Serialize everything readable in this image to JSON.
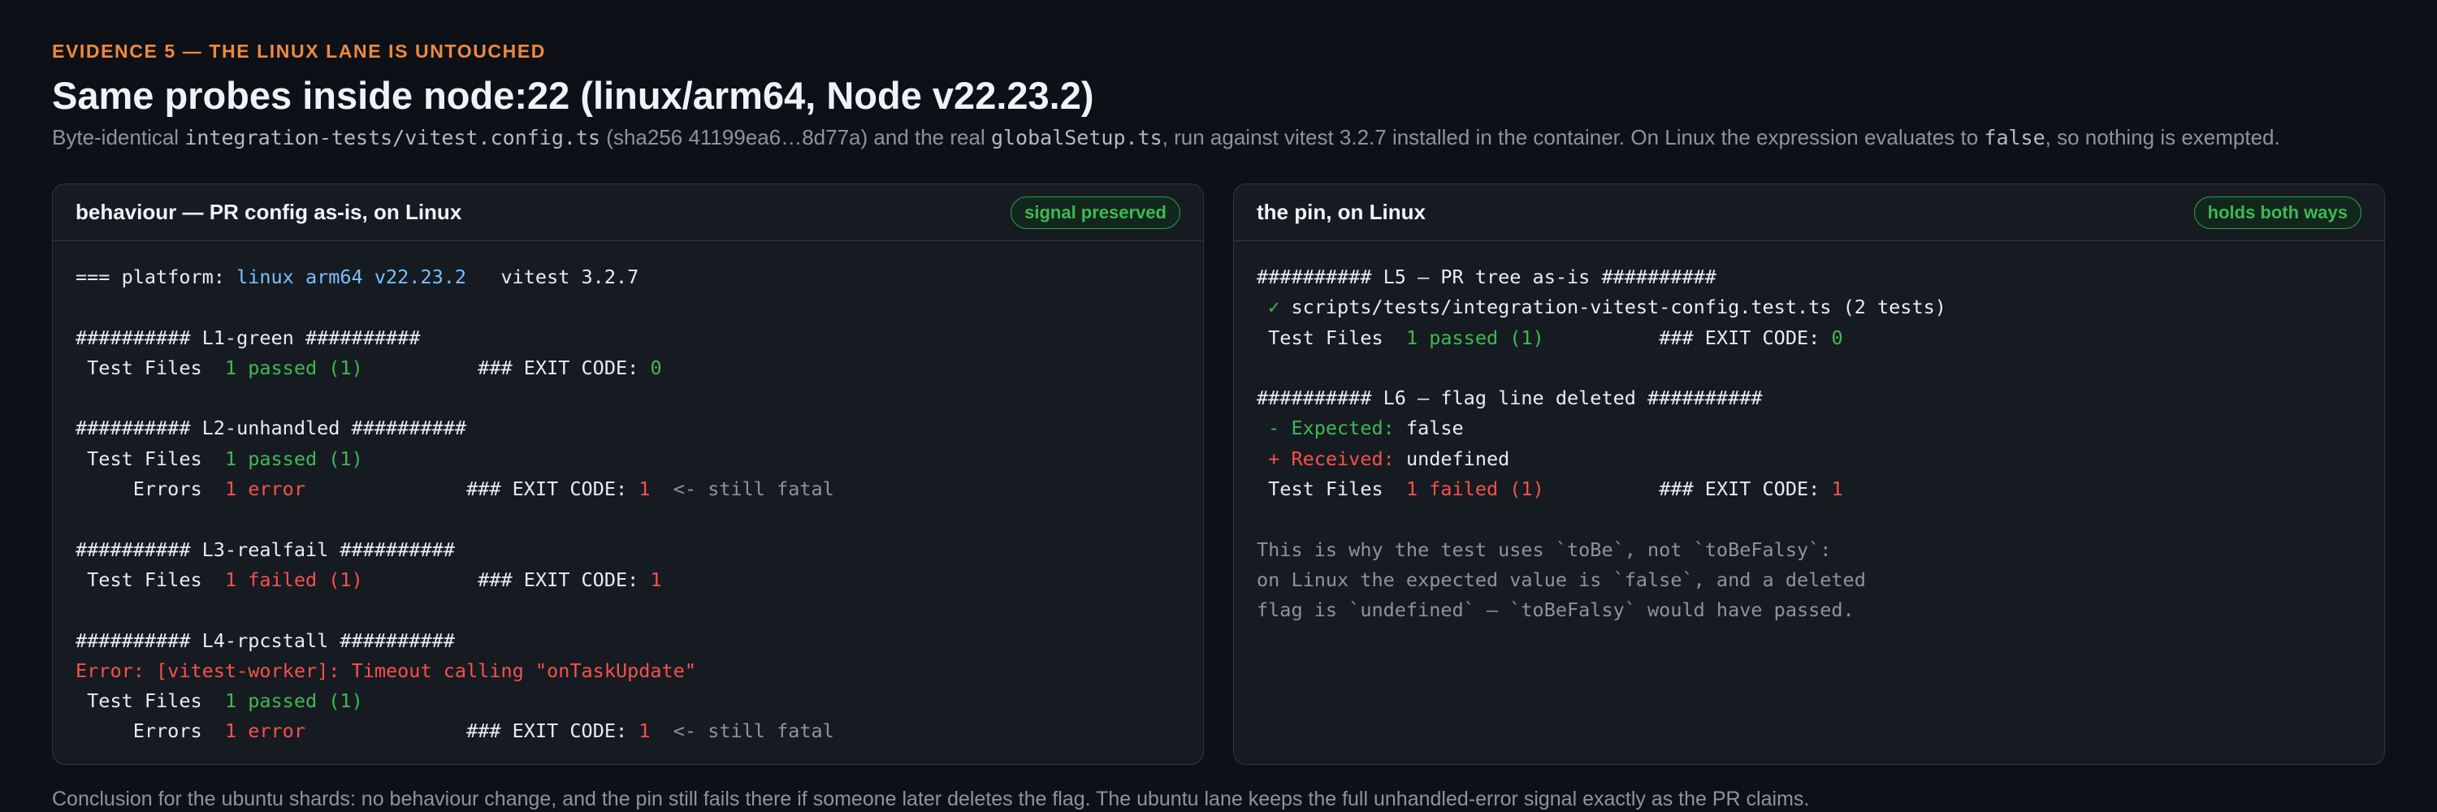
{
  "header": {
    "eyebrow": "EVIDENCE 5 — THE LINUX LANE IS UNTOUCHED",
    "title": "Same probes inside node:22 (linux/arm64, Node v22.23.2)",
    "subtitle": {
      "t1": "Byte-identical ",
      "c1": "integration-tests/vitest.config.ts",
      "t2": " (sha256 41199ea6…8d77a) and the real ",
      "c2": "globalSetup.ts",
      "t3": ", run against vitest 3.2.7 installed in the container. On Linux the expression evaluates to ",
      "c3": "false",
      "t4": ", so nothing is exempted."
    }
  },
  "left_panel": {
    "title": "behaviour — PR config as-is, on Linux",
    "badge": "signal preserved",
    "platform_prefix": "=== platform: ",
    "platform_value": "linux arm64 v22.23.2",
    "platform_suffix": "   vitest 3.2.7",
    "l1_header": "########## L1-green ##########",
    "test_files_label": " Test Files  ",
    "errors_label": "     Errors  ",
    "passed_1": "1 passed (1)",
    "failed_1": "1 failed (1)",
    "error_1": "1 error",
    "exit_label": "### EXIT CODE: ",
    "exit_0": "0",
    "exit_1": "1",
    "still_fatal": "  <- still fatal",
    "l2_header": "########## L2-unhandled ##########",
    "l3_header": "########## L3-realfail ##########",
    "l4_header": "########## L4-rpcstall ##########",
    "l4_error": "Error: [vitest-worker]: Timeout calling \"onTaskUpdate\""
  },
  "right_panel": {
    "title": "the pin, on Linux",
    "badge": "holds both ways",
    "l5_header": "########## L5 — PR tree as-is ##########",
    "check_mark": " ✓ ",
    "test_file": "scripts/tests/integration-vitest-config.test.ts (2 tests)",
    "test_files_label": " Test Files  ",
    "passed_1": "1 passed (1)",
    "failed_1": "1 failed (1)",
    "exit_label": "### EXIT CODE: ",
    "exit_0": "0",
    "exit_1": "1",
    "l6_header": "########## L6 — flag line deleted ##########",
    "expected_label": " - Expected: ",
    "expected_value": "false",
    "received_label": " + Received: ",
    "received_value": "undefined",
    "note_1": "This is why the test uses `toBe`, not `toBeFalsy`:",
    "note_2": "on Linux the expected value is `false`, and a deleted",
    "note_3": "flag is `undefined` — `toBeFalsy` would have passed."
  },
  "footer": {
    "conclusion": "Conclusion for the ubuntu shards: no behaviour change, and the pin still fails there if someone later deletes the flag. The ubuntu lane keeps the full unhandled-error signal exactly as the PR claims."
  },
  "colors": {
    "background": "#0d1117",
    "panel": "#161b22",
    "accent_orange": "#f0883e",
    "green": "#3fb950",
    "red": "#f85149",
    "blue": "#79c0ff",
    "muted": "#8b949e"
  }
}
